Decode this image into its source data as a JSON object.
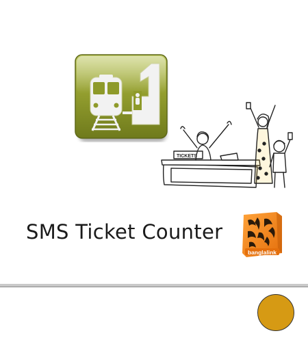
{
  "app": {
    "title": "SMS Ticket Counter",
    "icon_name": "train-ticket-app-icon",
    "icon_color": "#8e9a2a"
  },
  "illustration": {
    "booth_sign": "TICKETS",
    "icon_name": "happy-ticket-buyers-illustration"
  },
  "brand": {
    "name": "banglalink",
    "color": "#f58220"
  },
  "indicator": {
    "color": "#d69a14"
  }
}
